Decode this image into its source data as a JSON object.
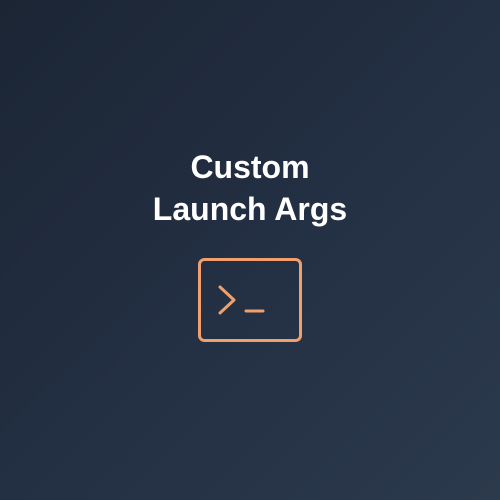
{
  "title": {
    "line1": "Custom",
    "line2": "Launch Args"
  },
  "icon": {
    "name": "terminal-icon",
    "color": "#f0a06c"
  },
  "background": {
    "from": "#1b2534",
    "to": "#2c3a4d"
  }
}
